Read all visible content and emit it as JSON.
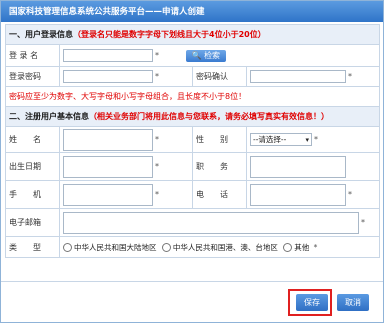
{
  "window": {
    "title": "国家科技管理信息系统公共服务平台——申请人创建"
  },
  "section1": {
    "title": "一、用户登录信息",
    "note": "（登录名只能是数字字母下划线且大于4位小于20位）",
    "login_name_label": "登 录 名",
    "search_label": "检索",
    "password_label": "登录密码",
    "confirm_label": "密码确认",
    "password_rule": "密码应至少为数字、大写字母和小写字母组合，且长度不小于8位！"
  },
  "section2": {
    "title": "二、注册用户基本信息",
    "note": "（相关业务部门将用此信息与您联系，请务必填写真实有效信息！）",
    "name_label": "姓　　名",
    "gender_label": "性　　别",
    "gender_value": "--请选择--",
    "birth_label": "出生日期",
    "position_label": "职　　务",
    "mobile_label": "手　　机",
    "phone_label": "电　　话",
    "email_label": "电子邮箱",
    "type_label": "类　　型",
    "type_options": [
      "中华人民共和国大陆地区",
      "中华人民共和国港、澳、台地区",
      "其他"
    ]
  },
  "required_mark": "*",
  "footer": {
    "save_label": "保存",
    "cancel_label": "取消"
  },
  "colors": {
    "title_bar": "#2f74c8",
    "section_bg": "#e8eff8",
    "warning": "#e00000",
    "highlight": "#e02020"
  }
}
